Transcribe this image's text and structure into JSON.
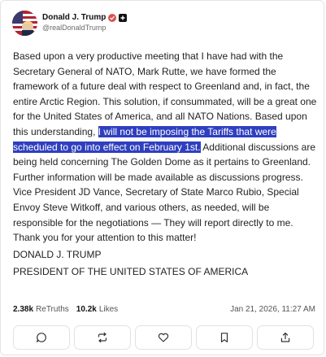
{
  "author": {
    "name": "Donald J. Trump",
    "handle": "@realDonaldTrump"
  },
  "post": {
    "text_before": "Based upon a very productive meeting that I have had with the Secretary General of NATO, Mark Rutte, we have formed the framework of a future deal with respect to Greenland and, in fact, the entire Arctic Region. This solution, if consummated, will be a great one for the United States of America, and all NATO Nations. Based upon this understanding, ",
    "text_highlighted": "I will not be imposing the Tariffs that were scheduled to go into effect on February 1st.",
    "text_after": " Additional discussions are being held concerning The Golden Dome as it pertains to Greenland. Further information will be made available as discussions progress. Vice President JD Vance, Secretary of State Marco Rubio, Special Envoy Steve Witkoff, and various others, as needed, will be responsible for the negotiations — They will report directly to me. Thank you for your attention to this matter!",
    "signature_line1": "DONALD J. TRUMP",
    "signature_line2": "PRESIDENT OF THE UNITED STATES OF AMERICA"
  },
  "stats": {
    "retruths_count": "2.38k",
    "retruths_label": "ReTruths",
    "likes_count": "10.2k",
    "likes_label": "Likes",
    "timestamp": "Jan 21, 2026, 11:27 AM"
  },
  "actions": [
    {
      "icon": "reply-icon"
    },
    {
      "icon": "retruth-icon"
    },
    {
      "icon": "like-icon"
    },
    {
      "icon": "bookmark-icon"
    },
    {
      "icon": "share-icon"
    }
  ],
  "colors": {
    "highlight": "#2f3fbf",
    "verified_badge": "#d9534f"
  }
}
